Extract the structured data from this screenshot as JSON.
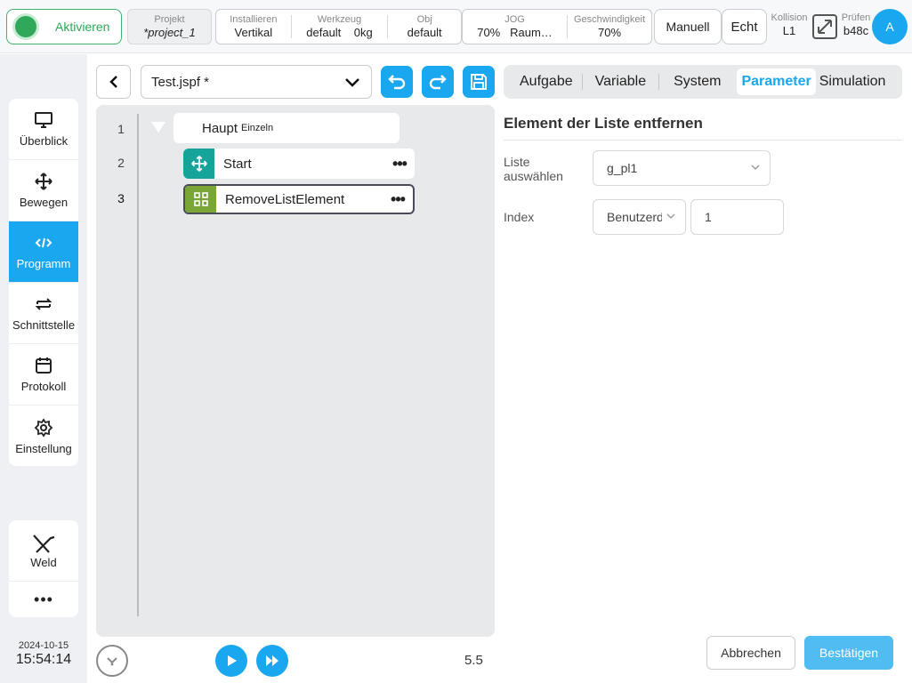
{
  "topbar": {
    "activate_label": "Aktivieren",
    "project": {
      "caption": "Projekt",
      "value": "*project_1"
    },
    "install": {
      "caption": "Installieren",
      "value": "Vertikal"
    },
    "tool": {
      "caption": "Werkzeug",
      "value_name": "default",
      "value_weight": "0kg"
    },
    "obj": {
      "caption": "Obj",
      "value": "default"
    },
    "jog": {
      "caption": "JOG",
      "value_speed": "70%",
      "value_space": "Raum…"
    },
    "speed": {
      "caption": "Geschwindigkeit",
      "value": "70%"
    },
    "manual_label": "Manuell",
    "real_label": "Echt",
    "collision": {
      "caption": "Kollision",
      "value": "L1"
    },
    "check": {
      "caption": "Prüfen",
      "value": "b48c"
    },
    "avatar_label": "A"
  },
  "sidebar": {
    "items": [
      {
        "label": "Überblick",
        "icon": "monitor-icon"
      },
      {
        "label": "Bewegen",
        "icon": "move-icon"
      },
      {
        "label": "Programm",
        "icon": "code-icon"
      },
      {
        "label": "Schnittstelle",
        "icon": "swap-icon"
      },
      {
        "label": "Protokoll",
        "icon": "calendar-icon"
      },
      {
        "label": "Einstellung",
        "icon": "gear-icon"
      }
    ],
    "weld_label": "Weld",
    "more_label": "•••",
    "date": "2024-10-15",
    "time": "15:54:14"
  },
  "editor": {
    "file_name": "Test.jspf *",
    "line_numbers": [
      "1",
      "2",
      "3"
    ],
    "main_node": {
      "label": "Haupt",
      "sub": "Einzeln"
    },
    "nodes": [
      {
        "label": "Start",
        "color": "#15a39a"
      },
      {
        "label": "RemoveListElement",
        "color": "#7aa637"
      }
    ],
    "more_label": "•••",
    "version": "5.5"
  },
  "panel": {
    "tabs": [
      "Aufgabe",
      "Variable",
      "System",
      "Parameter",
      "Simulation"
    ],
    "active_tab": "Parameter",
    "title": "Element der Liste entfernen",
    "list_label_1": "Liste",
    "list_label_2": "auswählen",
    "list_value": "g_pl1",
    "index_label": "Index",
    "index_type": "Benutzerdefiniert",
    "index_value": "1",
    "cancel_label": "Abbrechen",
    "confirm_label": "Bestätigen"
  },
  "colors": {
    "accent": "#19a7f0",
    "active_green": "#2fa85a"
  }
}
